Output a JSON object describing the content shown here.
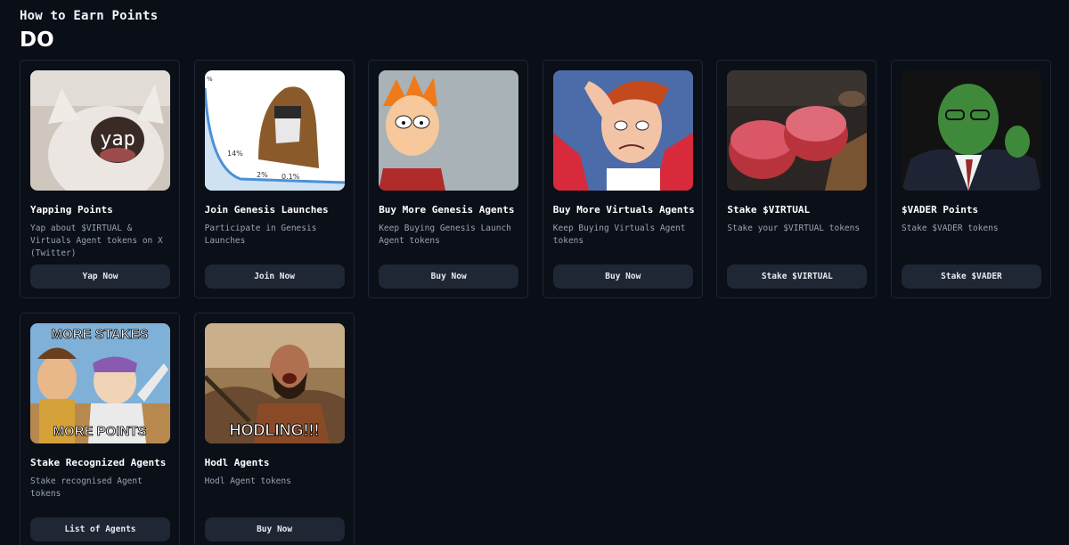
{
  "header": {
    "title": "How to Earn Points",
    "section": "DO"
  },
  "cards": [
    {
      "title": "Yapping Points",
      "description": "Yap about $VIRTUAL & Virtuals Agent tokens on X (Twitter)",
      "button": "Yap Now",
      "image": "yap-cat-meme",
      "image_text": "yap"
    },
    {
      "title": "Join Genesis Launches",
      "description": "Participate in Genesis Launches",
      "button": "Join Now",
      "image": "hooded-wojak-chart-meme",
      "image_labels": [
        "%",
        "14%",
        "2%",
        "0.1%"
      ]
    },
    {
      "title": "Buy More Genesis Agents",
      "description": "Keep Buying Genesis Launch Agent tokens",
      "button": "Buy Now",
      "image": "squinting-fry-meme"
    },
    {
      "title": "Buy More Virtuals Agents",
      "description": "Keep Buying Virtuals Agent tokens",
      "button": "Buy Now",
      "image": "sweating-man-meme"
    },
    {
      "title": "Stake $VIRTUAL",
      "description": "Stake your $VIRTUAL tokens",
      "button": "Stake $VIRTUAL",
      "image": "raw-steak-photo"
    },
    {
      "title": "$VADER Points",
      "description": "Stake $VADER tokens",
      "button": "Stake $VADER",
      "image": "green-man-portrait"
    },
    {
      "title": "Stake Recognized Agents",
      "description": "Stake recognised Agent tokens",
      "button": "List of Agents",
      "image": "toy-story-everywhere-meme",
      "image_top_text": "MORE STAKES",
      "image_bottom_text": "MORE POINTS"
    },
    {
      "title": "Hodl Agents",
      "description": "Hodl Agent tokens",
      "button": "Buy Now",
      "image": "spartan-warrior-meme",
      "image_bottom_text": "HODLING!!!"
    }
  ],
  "colors": {
    "background": "#0a0e17",
    "card_border": "#1f2633",
    "button": "#1f2735",
    "desc_text": "#9aa3b2"
  }
}
